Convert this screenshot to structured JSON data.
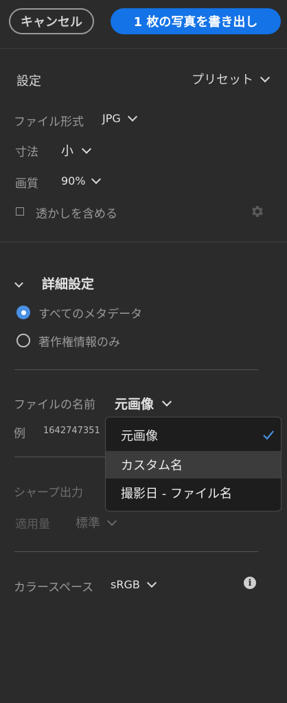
{
  "header": {
    "cancel_label": "キャンセル",
    "export_label": "1 枚の写真を書き出し"
  },
  "settings": {
    "title": "設定",
    "preset_label": "プリセット",
    "file_format": {
      "label": "ファイル形式",
      "value": "JPG"
    },
    "size": {
      "label": "寸法",
      "value": "小"
    },
    "quality": {
      "label": "画質",
      "value": "90%"
    },
    "watermark": {
      "label": "透かしを含める",
      "checked": false
    }
  },
  "advanced": {
    "title": "詳細設定",
    "metadata_options": [
      {
        "label": "すべてのメタデータ",
        "selected": true
      },
      {
        "label": "著作権情報のみ",
        "selected": false
      }
    ],
    "filename": {
      "label": "ファイルの名前",
      "value": "元画像",
      "example_label": "例",
      "example_value": "1642747351"
    },
    "sharpen": {
      "label": "シャープ出力",
      "amount_label": "適用量",
      "amount_value": "標準"
    },
    "color_space": {
      "label": "カラースペース",
      "value": "sRGB"
    }
  },
  "filename_dropdown": {
    "items": [
      {
        "label": "元画像",
        "checked": true
      },
      {
        "label": "カスタム名",
        "checked": false
      },
      {
        "label": "撮影日 - ファイル名",
        "checked": false
      }
    ]
  },
  "colors": {
    "accent": "#1473e6",
    "background": "#2b2b2b",
    "check": "#4a90e2"
  }
}
